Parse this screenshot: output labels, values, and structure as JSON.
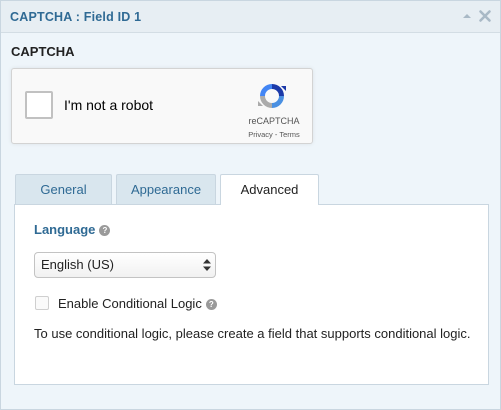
{
  "header": {
    "title": "CAPTCHA : Field ID 1",
    "collapse_icon": "chevron-up-icon",
    "close_icon": "close-icon",
    "icon_color": "#a9b9c6",
    "title_color": "#2f6a94"
  },
  "field": {
    "label": "CAPTCHA"
  },
  "recaptcha": {
    "checkbox_label": "I'm not a robot",
    "brand": "reCAPTCHA",
    "terms": "Privacy - Terms",
    "logo_icon": "recaptcha-logo-icon"
  },
  "tabs": [
    {
      "label": "General",
      "active": false
    },
    {
      "label": "Appearance",
      "active": false
    },
    {
      "label": "Advanced",
      "active": true
    }
  ],
  "advanced": {
    "language_label": "Language",
    "help_icon": "question-circle-icon",
    "language_value": "English (US)",
    "conditional_label": "Enable Conditional Logic",
    "conditional_checked": false,
    "conditional_message": "To use conditional logic, please create a field that supports conditional logic."
  }
}
